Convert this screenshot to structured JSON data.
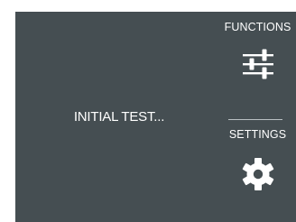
{
  "status": {
    "text": "INITIAL TEST..."
  },
  "menu": {
    "functions_label": "FUNCTIONS",
    "functions_icon": "sliders-icon",
    "settings_label": "SETTINGS",
    "settings_icon": "gear-icon"
  },
  "colors": {
    "screen_background": "#454e52",
    "text": "#ffffff",
    "divider": "#b9c0c3"
  }
}
